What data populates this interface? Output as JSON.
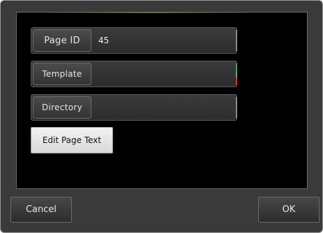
{
  "fields": [
    {
      "label": "Page ID",
      "value": "45"
    },
    {
      "label": "Template",
      "value": ""
    },
    {
      "label": "Directory",
      "value": ""
    }
  ],
  "edit_button_label": "Edit Page Text",
  "footer": {
    "cancel_label": "Cancel",
    "ok_label": "OK"
  }
}
